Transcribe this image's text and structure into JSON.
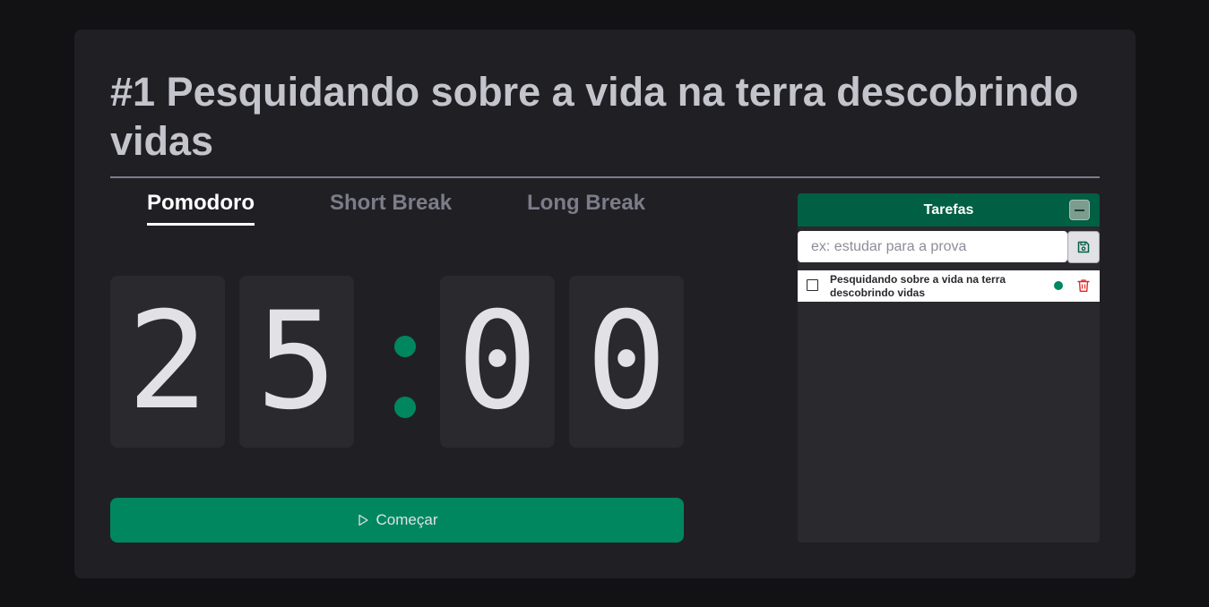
{
  "page": {
    "title": "#1 Pesquidando sobre a vida na terra descobrindo vidas"
  },
  "tabs": [
    {
      "label": "Pomodoro",
      "active": true
    },
    {
      "label": "Short Break",
      "active": false
    },
    {
      "label": "Long Break",
      "active": false
    }
  ],
  "timer": {
    "minutes_tens": "2",
    "minutes_ones": "5",
    "seconds_tens": "0",
    "seconds_ones": "0"
  },
  "start_button": {
    "label": "Começar",
    "icon": "play-icon"
  },
  "tasks": {
    "title": "Tarefas",
    "collapse_icon": "minus-icon",
    "input_placeholder": "ex: estudar para a prova",
    "save_icon": "save-icon",
    "items": [
      {
        "text": "Pesquidando sobre a vida na terra descobrindo vidas",
        "checked": false,
        "status_color": "#00875f",
        "delete_icon": "trash-icon"
      }
    ]
  },
  "colors": {
    "background": "#121214",
    "card": "#202024",
    "accent": "#00875f",
    "tasks_header": "#015f43",
    "delete": "#e02a2a"
  }
}
